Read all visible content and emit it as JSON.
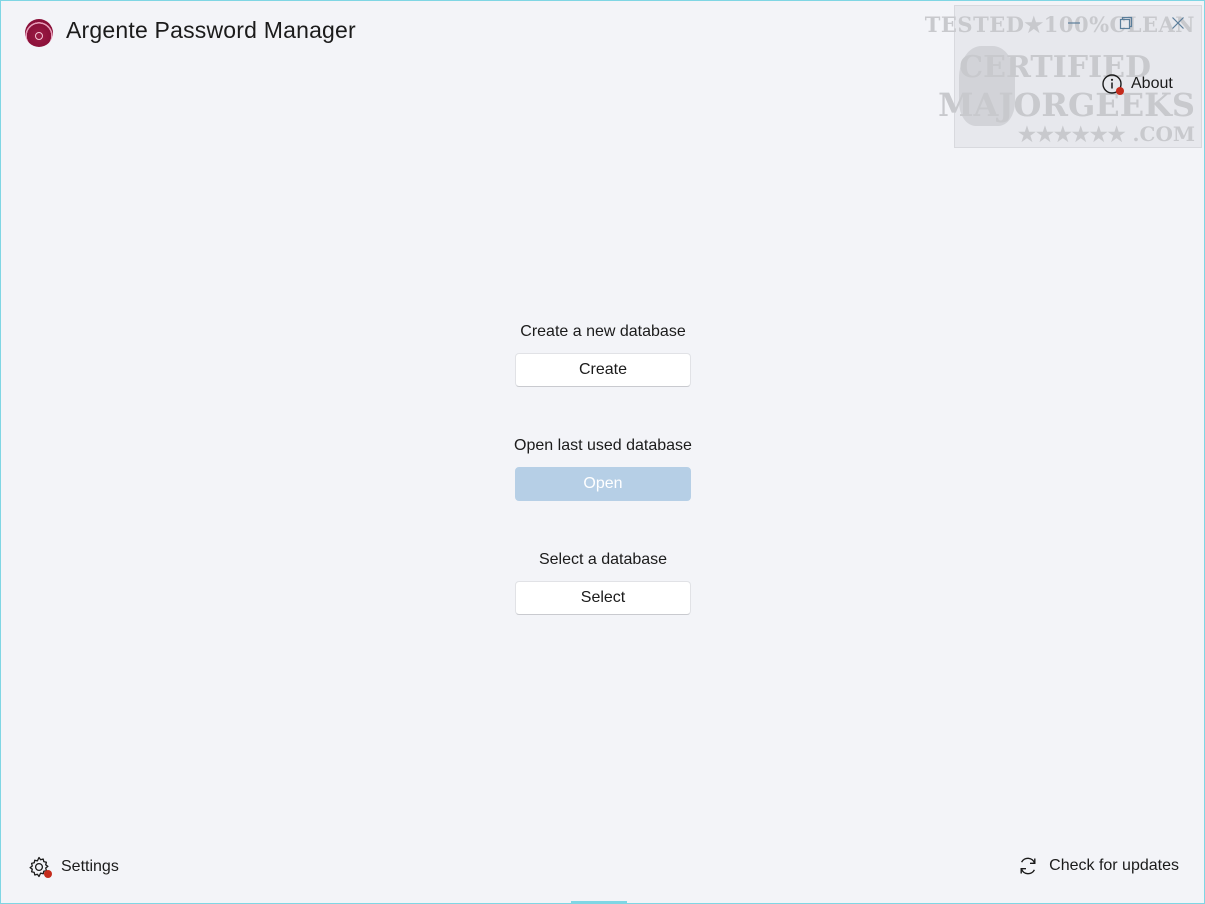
{
  "app": {
    "title": "Argente Password Manager",
    "accent_color": "#9c1b45"
  },
  "window_controls": {
    "minimize_icon": "minimize-icon",
    "maximize_icon": "restore-icon",
    "close_icon": "close-icon"
  },
  "watermark": {
    "line1": "TESTED★100%CLEAN",
    "line2": "CERTIFIED",
    "line3": "MAJORGEEKS",
    "line4": "★★★★★★ .COM"
  },
  "header": {
    "about_label": "About",
    "about_icon": "info-icon"
  },
  "actions": {
    "create": {
      "label": "Create a new database",
      "button": "Create"
    },
    "open": {
      "label": "Open last used database",
      "button": "Open",
      "disabled": true
    },
    "select": {
      "label": "Select a database",
      "button": "Select"
    }
  },
  "footer": {
    "settings_label": "Settings",
    "settings_icon": "gear-icon",
    "updates_label": "Check for updates",
    "updates_icon": "refresh-icon"
  },
  "colors": {
    "background": "#f3f4f8",
    "disabled_button": "#b6cfe6",
    "notification_badge": "#c42b1c",
    "window_border": "#7fd6e4"
  }
}
